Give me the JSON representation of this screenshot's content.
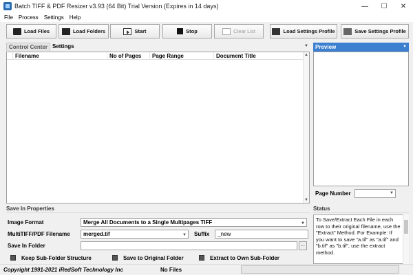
{
  "window": {
    "title": "Batch TIFF & PDF Resizer v3.93 (64 Bit)  Trial Version (Expires in 14 days)",
    "minimize": "—",
    "maximize": "☐",
    "close": "✕"
  },
  "menu": [
    "File",
    "Process",
    "Settings",
    "Help"
  ],
  "toolbar": {
    "load_files": "Load Files",
    "load_folders": "Load Folders",
    "start": "Start",
    "stop": "Stop",
    "clear_list": "Clear List",
    "load_profile": "Load Settings Profile",
    "save_profile": "Save Settings Profile"
  },
  "tabs": [
    "Control Center",
    "Settings"
  ],
  "file_table": {
    "columns": [
      "Filename",
      "No of Pages",
      "Page Range",
      "Document Title"
    ],
    "rows": []
  },
  "preview": {
    "title": "Preview",
    "page_number_label": "Page Number",
    "page_number_value": ""
  },
  "save_props": {
    "title": "Save In Properties",
    "image_format_label": "Image Format",
    "image_format_value": "Merge All Documents to a Single Multipages TIFF",
    "multi_filename_label": "MultiTIFF/PDF Filename",
    "multi_filename_value": "merged.tif",
    "suffix_label": "Suffix",
    "suffix_value": "_new",
    "save_in_folder_label": "Save In Folder",
    "save_in_folder_value": "",
    "browse": "...",
    "checkboxes": [
      "Keep Sub-Folder Structure",
      "Save to Original Folder",
      "Extract to Own Sub-Folder"
    ]
  },
  "status": {
    "title": "Status",
    "text": "To Save/Extract Each File in each row to their original filename, use the \"Extract\" Method. For Example: If you want to save \"a.tif\" as \"a.tif\" and \"b.tif\" as \"b.tif\", use the extract method."
  },
  "statusbar": {
    "copyright": "Copyright 1991-2021 iRedSoft Technology Inc",
    "file_count": "No Files",
    "progress_fraction": 0
  },
  "colors": {
    "accent": "#3c7fd0",
    "progress": "#06b025"
  }
}
